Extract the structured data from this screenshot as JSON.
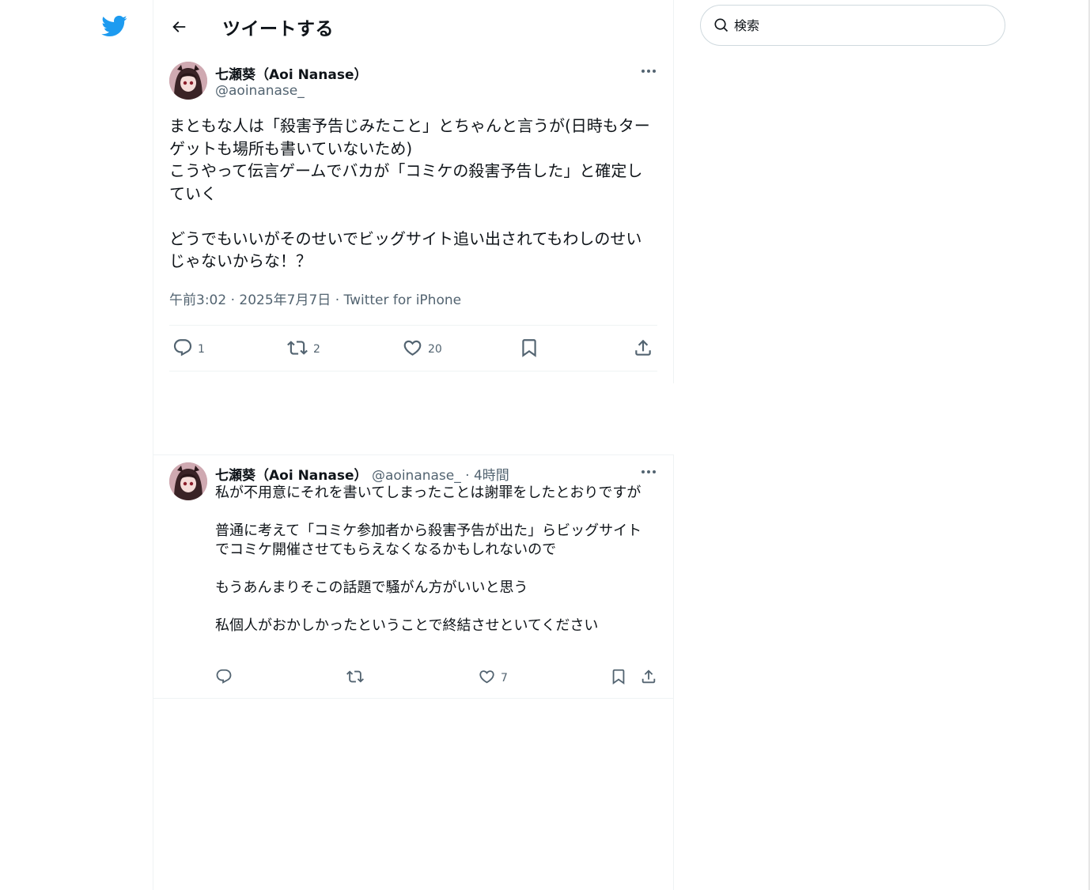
{
  "header": {
    "title": "ツイートする"
  },
  "search": {
    "placeholder": "検索"
  },
  "tweet": {
    "author_name": "七瀬葵（Aoi Nanase）",
    "author_handle": "@aoinanase_",
    "text": "まともな人は「殺害予告じみたこと」とちゃんと言うが(日時もターゲットも場所も書いていないため)\nこうやって伝言ゲームでバカが「コミケの殺害予告した」と確定していく\n\nどうでもいいがそのせいでビッグサイト追い出されてもわしのせいじゃないからな！？",
    "time": "午前3:02",
    "date": "2025年7月7日",
    "source": "Twitter for iPhone",
    "separator": " · ",
    "stats": {
      "replies": "1",
      "retweets": "2",
      "likes": "20"
    }
  },
  "reply": {
    "author_name": "七瀬葵（Aoi Nanase）",
    "author_handle": "@aoinanase_",
    "time_ago": "· 4時間",
    "text": "私が不用意にそれを書いてしまったことは謝罪をしたとおりですが\n\n普通に考えて「コミケ参加者から殺害予告が出た」らビッグサイトでコミケ開催させてもらえなくなるかもしれないので\n\nもうあんまりそこの話題で騒がん方がいいと思う\n\n私個人がおかしかったということで終結させといてください",
    "stats": {
      "likes": "7"
    }
  },
  "colors": {
    "brand": "#1d9bf0",
    "text": "#0f1419",
    "secondary": "#536471",
    "border": "#eff3f4"
  },
  "icons": [
    "twitter-logo-icon",
    "back-arrow-icon",
    "search-icon",
    "more-icon",
    "reply-icon",
    "retweet-icon",
    "like-icon",
    "bookmark-icon",
    "share-icon"
  ]
}
